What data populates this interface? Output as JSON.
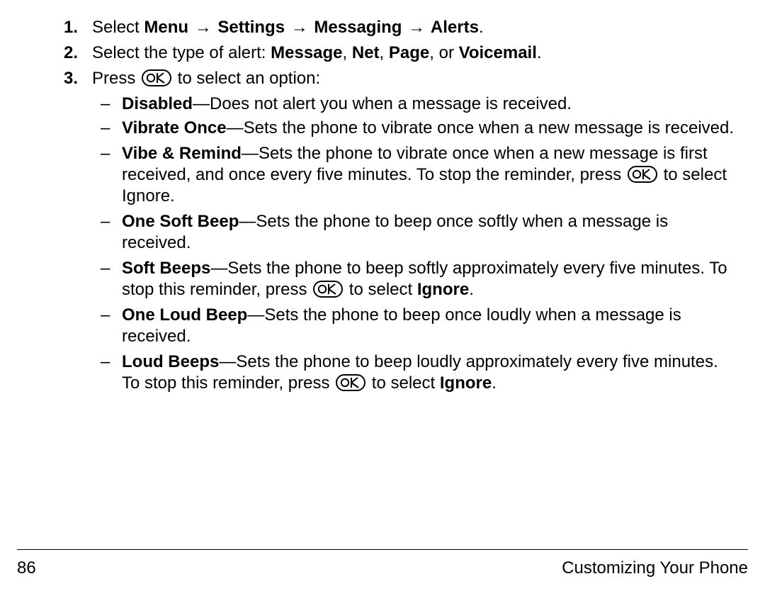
{
  "steps": {
    "s1": {
      "num": "1.",
      "prefix": "Select ",
      "menu": "Menu",
      "settings": "Settings",
      "messaging": "Messaging",
      "alerts": "Alerts",
      "period": "."
    },
    "s2": {
      "num": "2.",
      "prefix": "Select the type of alert: ",
      "o1": "Message",
      "c1": ", ",
      "o2": "Net",
      "c2": ", ",
      "o3": "Page",
      "c3": ", or ",
      "o4": "Voicemail",
      "period": "."
    },
    "s3": {
      "num": "3.",
      "prefix": "Press ",
      "suffix": " to select an option:"
    }
  },
  "options": {
    "disabled": {
      "name": "Disabled",
      "desc": "—Does not alert you when a message is received."
    },
    "vibrate_once": {
      "name": "Vibrate Once",
      "desc": "—Sets the phone to vibrate once when a new message is received."
    },
    "vibe_remind": {
      "name": "Vibe & Remind",
      "desc1": "—Sets the phone to vibrate once when a new message is first received, and once every five minutes. To stop the reminder, press ",
      "desc2": " to select Ignore."
    },
    "one_soft_beep": {
      "name": "One Soft Beep",
      "desc": "—Sets the phone to beep once softly when a message is received."
    },
    "soft_beeps": {
      "name": "Soft Beeps",
      "desc1": "—Sets the phone to beep softly approximately every five minutes. To stop this reminder, press ",
      "desc2": " to select ",
      "ignore": "Ignore",
      "period": "."
    },
    "one_loud_beep": {
      "name": "One Loud Beep",
      "desc": "—Sets the phone to beep once loudly when a message is received."
    },
    "loud_beeps": {
      "name": "Loud Beeps",
      "desc1": "—Sets the phone to beep loudly approximately every five minutes. To stop this reminder, press ",
      "desc2": " to select ",
      "ignore": "Ignore",
      "period": "."
    }
  },
  "arrow": "→",
  "footer": {
    "page": "86",
    "section": "Customizing Your Phone"
  }
}
